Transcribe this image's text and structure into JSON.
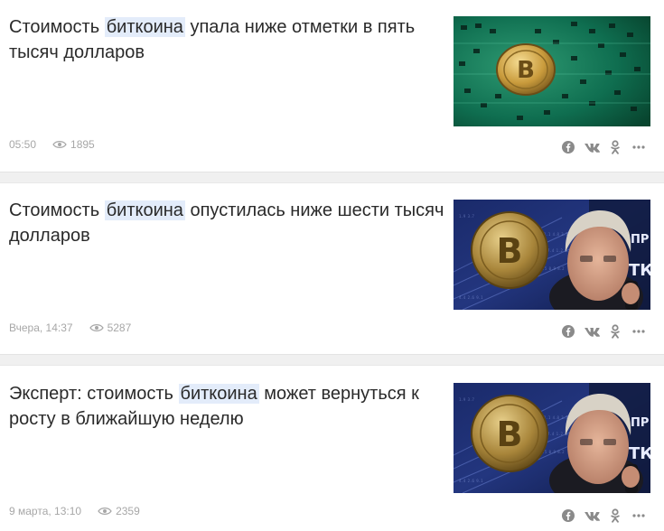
{
  "articles": [
    {
      "title_before": "Стоимость ",
      "title_highlight": "биткоина",
      "title_after": " упала ниже отметки в пять тысяч долларов",
      "time": "05:50",
      "views": "1895",
      "image_icon": "bitcoin-circuit-image"
    },
    {
      "title_before": "Стоимость ",
      "title_highlight": "биткоина",
      "title_after": " опустилась ниже шести тысяч долларов",
      "time": "Вчера, 14:37",
      "views": "5287",
      "image_icon": "bitcoin-man-phone-image"
    },
    {
      "title_before": "Эксперт: стоимость ",
      "title_highlight": "биткоина",
      "title_after": " может вернуться к росту в ближайшую неделю",
      "time": "9 марта, 13:10",
      "views": "2359",
      "image_icon": "bitcoin-man-phone-image"
    }
  ],
  "share_icons": [
    "facebook-icon",
    "vk-icon",
    "odnoklassniki-icon",
    "more-icon"
  ],
  "colors": {
    "highlight": "#e3ecfa",
    "meta_text": "#a7a7a7",
    "icon": "#8a8a8a",
    "separator": "#f0f0f0"
  }
}
